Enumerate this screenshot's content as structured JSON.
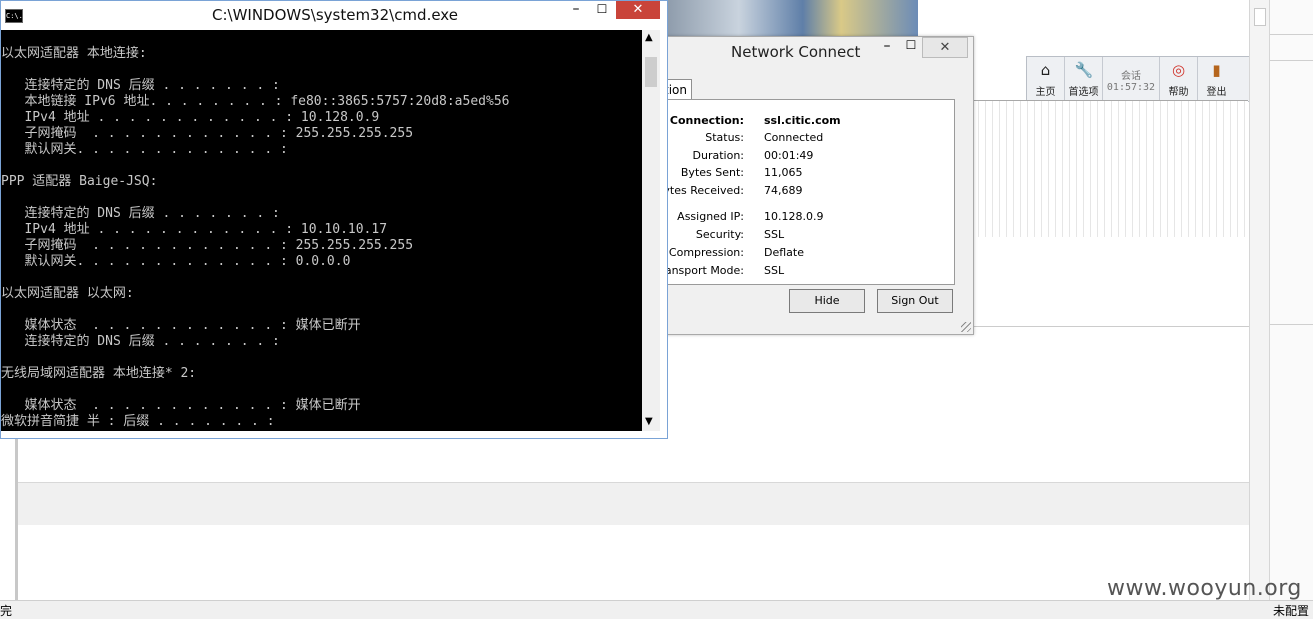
{
  "cmd": {
    "title": "C:\\WINDOWS\\system32\\cmd.exe",
    "icon_text": "C:\\.",
    "lines": [
      "以太网适配器 本地连接:",
      "",
      "   连接特定的 DNS 后缀 . . . . . . . :",
      "   本地链接 IPv6 地址. . . . . . . . : fe80::3865:5757:20d8:a5ed%56",
      "   IPv4 地址 . . . . . . . . . . . . : 10.128.0.9",
      "   子网掩码  . . . . . . . . . . . . : 255.255.255.255",
      "   默认网关. . . . . . . . . . . . . :",
      "",
      "PPP 适配器 Baige-JSQ:",
      "",
      "   连接特定的 DNS 后缀 . . . . . . . :",
      "   IPv4 地址 . . . . . . . . . . . . : 10.10.10.17",
      "   子网掩码  . . . . . . . . . . . . : 255.255.255.255",
      "   默认网关. . . . . . . . . . . . . : 0.0.0.0",
      "",
      "以太网适配器 以太网:",
      "",
      "   媒体状态  . . . . . . . . . . . . : 媒体已断开",
      "   连接特定的 DNS 后缀 . . . . . . . :",
      "",
      "无线局域网适配器 本地连接* 2:",
      "",
      "   媒体状态  . . . . . . . . . . . . : 媒体已断开",
      "微软拼音简捷 半 : 后缀 . . . . . . . :"
    ]
  },
  "network_connect": {
    "title": "Network Connect",
    "tab_label": "tion",
    "rows": [
      {
        "key": "Connection:",
        "value": "ssl.citic.com"
      },
      {
        "key": "Status:",
        "value": "Connected"
      },
      {
        "key": "Duration:",
        "value": "00:01:49"
      },
      {
        "key": "Bytes Sent:",
        "value": "11,065"
      },
      {
        "key": "Bytes Received:",
        "value": "74,689"
      },
      {
        "key": "Assigned IP:",
        "value": "10.128.0.9"
      },
      {
        "key": "Security:",
        "value": "SSL"
      },
      {
        "key": "Compression:",
        "value": "Deflate"
      },
      {
        "key": "Transport Mode:",
        "value": "SSL"
      }
    ],
    "hide_label": "Hide",
    "signout_label": "Sign Out"
  },
  "toolbar": {
    "home_label": "主页",
    "options_label": "首选项",
    "session_label": "会话",
    "session_time": "01:57:32",
    "help_label": "帮助",
    "logout_label": "登出"
  },
  "status": {
    "left": "完",
    "right": "未配置"
  },
  "watermark": "www.wooyun.org"
}
